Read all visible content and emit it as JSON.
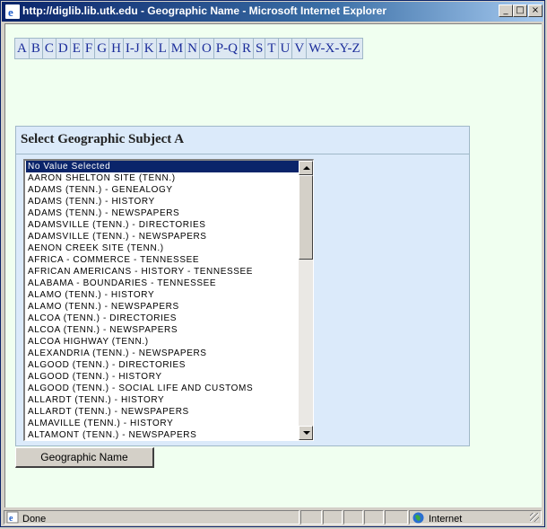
{
  "window": {
    "title": "http://diglib.lib.utk.edu - Geographic Name - Microsoft Internet Explorer",
    "minimize": "_",
    "maximize": "□",
    "close": "×"
  },
  "alphabet": [
    "A",
    "B",
    "C",
    "D",
    "E",
    "F",
    "G",
    "H",
    "I-J",
    "K",
    "L",
    "M",
    "N",
    "O",
    "P-Q",
    "R",
    "S",
    "T",
    "U",
    "V",
    "W-X-Y-Z"
  ],
  "panel": {
    "heading": "Select Geographic Subject A",
    "options": [
      "No Value Selected",
      "AARON SHELTON SITE (TENN.)",
      "ADAMS (TENN.) - GENEALOGY",
      "ADAMS (TENN.) - HISTORY",
      "ADAMS (TENN.) - NEWSPAPERS",
      "ADAMSVILLE (TENN.) - DIRECTORIES",
      "ADAMSVILLE (TENN.) - NEWSPAPERS",
      "AENON CREEK SITE (TENN.)",
      "AFRICA - COMMERCE - TENNESSEE",
      "AFRICAN AMERICANS - HISTORY - TENNESSEE",
      "ALABAMA - BOUNDARIES - TENNESSEE",
      "ALAMO (TENN.) - HISTORY",
      "ALAMO (TENN.) - NEWSPAPERS",
      "ALCOA (TENN.) - DIRECTORIES",
      "ALCOA (TENN.) - NEWSPAPERS",
      "ALCOA HIGHWAY (TENN.)",
      "ALEXANDRIA (TENN.) - NEWSPAPERS",
      "ALGOOD (TENN.) - DIRECTORIES",
      "ALGOOD (TENN.) - HISTORY",
      "ALGOOD (TENN.) - SOCIAL LIFE AND CUSTOMS",
      "ALLARDT (TENN.) - HISTORY",
      "ALLARDT (TENN.) - NEWSPAPERS",
      "ALMAVILLE (TENN.) - HISTORY",
      "ALTAMONT (TENN.) - NEWSPAPERS"
    ],
    "selected_index": 0
  },
  "button": {
    "label": "Geographic Name"
  },
  "status": {
    "text": "Done",
    "zone": "Internet"
  },
  "colors": {
    "selection": "#0a246a",
    "link": "#1a2c9a",
    "page_bg": "#f0fff0",
    "panel_bg": "#dbeafa"
  }
}
